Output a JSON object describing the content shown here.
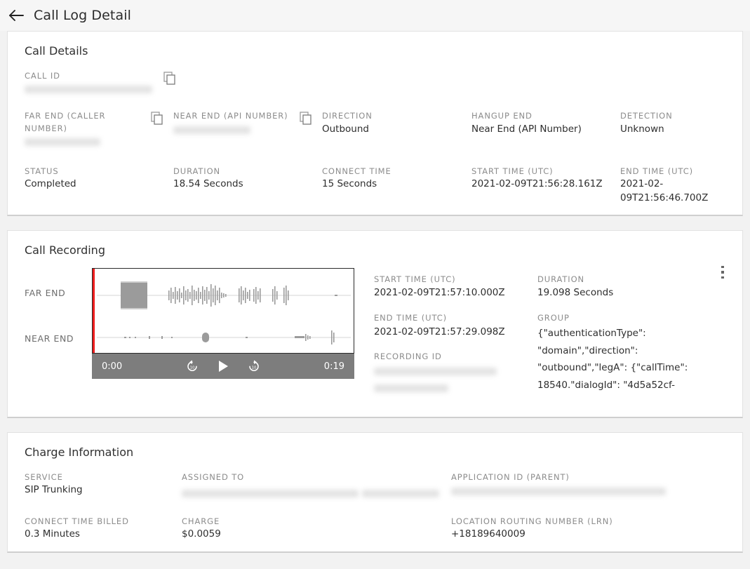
{
  "header": {
    "back_icon": "arrow-left-icon",
    "title": "Call Log Detail"
  },
  "call_details": {
    "title": "Call Details",
    "call_id": {
      "label": "CALL ID",
      "value": "",
      "redacted": true,
      "copy_icon": "copy-icon"
    },
    "fields_row1": [
      {
        "label": "FAR END (CALLER NUMBER)",
        "value": "",
        "redacted": true,
        "copy": true
      },
      {
        "label": "NEAR END (API NUMBER)",
        "value": "",
        "redacted": true,
        "copy": true
      },
      {
        "label": "DIRECTION",
        "value": "Outbound",
        "redacted": false,
        "copy": false
      },
      {
        "label": "HANGUP END",
        "value": "Near End (API Number)",
        "redacted": false,
        "copy": false
      },
      {
        "label": "DETECTION",
        "value": "Unknown",
        "redacted": false,
        "copy": false
      }
    ],
    "fields_row2": [
      {
        "label": "STATUS",
        "value": "Completed"
      },
      {
        "label": "DURATION",
        "value": "18.54 Seconds"
      },
      {
        "label": "CONNECT TIME",
        "value": "15 Seconds"
      },
      {
        "label": "START TIME (UTC)",
        "value": "2021-02-09T21:56:28.161Z"
      },
      {
        "label": "END TIME (UTC)",
        "value": "2021-02-09T21:56:46.700Z"
      }
    ]
  },
  "call_recording": {
    "title": "Call Recording",
    "track_labels": {
      "far": "FAR END",
      "near": "NEAR END"
    },
    "player": {
      "current_time": "0:00",
      "total_time": "0:19",
      "replay_icon": "replay-10-icon",
      "play_icon": "play-icon",
      "forward_icon": "forward-10-icon",
      "playhead_color": "#ee1c1c",
      "controls_bg": "#7d7d7d"
    },
    "menu_icon": "kebab-menu-icon",
    "fields": {
      "start_time_label": "START TIME (UTC)",
      "start_time_value": "2021-02-09T21:57:10.000Z",
      "end_time_label": "END TIME (UTC)",
      "end_time_value": "2021-02-09T21:57:29.098Z",
      "recording_id_label": "RECORDING ID",
      "recording_id_value": "",
      "duration_label": "DURATION",
      "duration_value": "19.098 Seconds",
      "group_label": "GROUP",
      "group_value": "{\"authenticationType\": \"domain\",\"direction\": \"outbound\",\"legA\": {\"callTime\": 18540.\"dialogId\": \"4d5a52cf-"
    }
  },
  "charge_information": {
    "title": "Charge Information",
    "row1": [
      {
        "label": "SERVICE",
        "value": "SIP Trunking",
        "redacted": false
      },
      {
        "label": "ASSIGNED TO",
        "value": "",
        "redacted": true
      },
      {
        "label": "APPLICATION ID (PARENT)",
        "value": "",
        "redacted": true
      }
    ],
    "row2": [
      {
        "label": "CONNECT TIME BILLED",
        "value": "0.3 Minutes"
      },
      {
        "label": "CHARGE",
        "value": "$0.0059"
      },
      {
        "label": "LOCATION ROUTING NUMBER (LRN)",
        "value": "+18189640009"
      }
    ]
  }
}
